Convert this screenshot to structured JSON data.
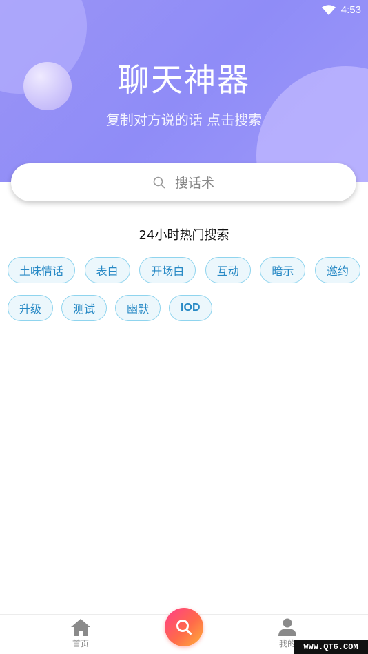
{
  "status": {
    "time": "4:53"
  },
  "hero": {
    "title": "聊天神器",
    "subtitle": "复制对方说的话 点击搜索"
  },
  "search": {
    "placeholder": "搜话术",
    "icon": "search-icon"
  },
  "hot": {
    "title": "24小时热门搜索",
    "row1": [
      "土味情话",
      "表白",
      "开场白",
      "互动",
      "暗示",
      "邀约"
    ],
    "row2": [
      "升级",
      "测试",
      "幽默",
      "IOD"
    ]
  },
  "tabbar": {
    "home_label": "首页",
    "me_label": "我的",
    "home_icon": "home-icon",
    "center_icon": "search-icon",
    "me_icon": "user-icon"
  },
  "watermark": "WWW.QT6.COM",
  "colors": {
    "hero": "#9a94f6",
    "tag_border": "#8fd4ee",
    "tag_bg": "#ecf7fc",
    "tag_text": "#2789c5",
    "fab_start": "#ff3d8a",
    "fab_end": "#ffb23a"
  }
}
